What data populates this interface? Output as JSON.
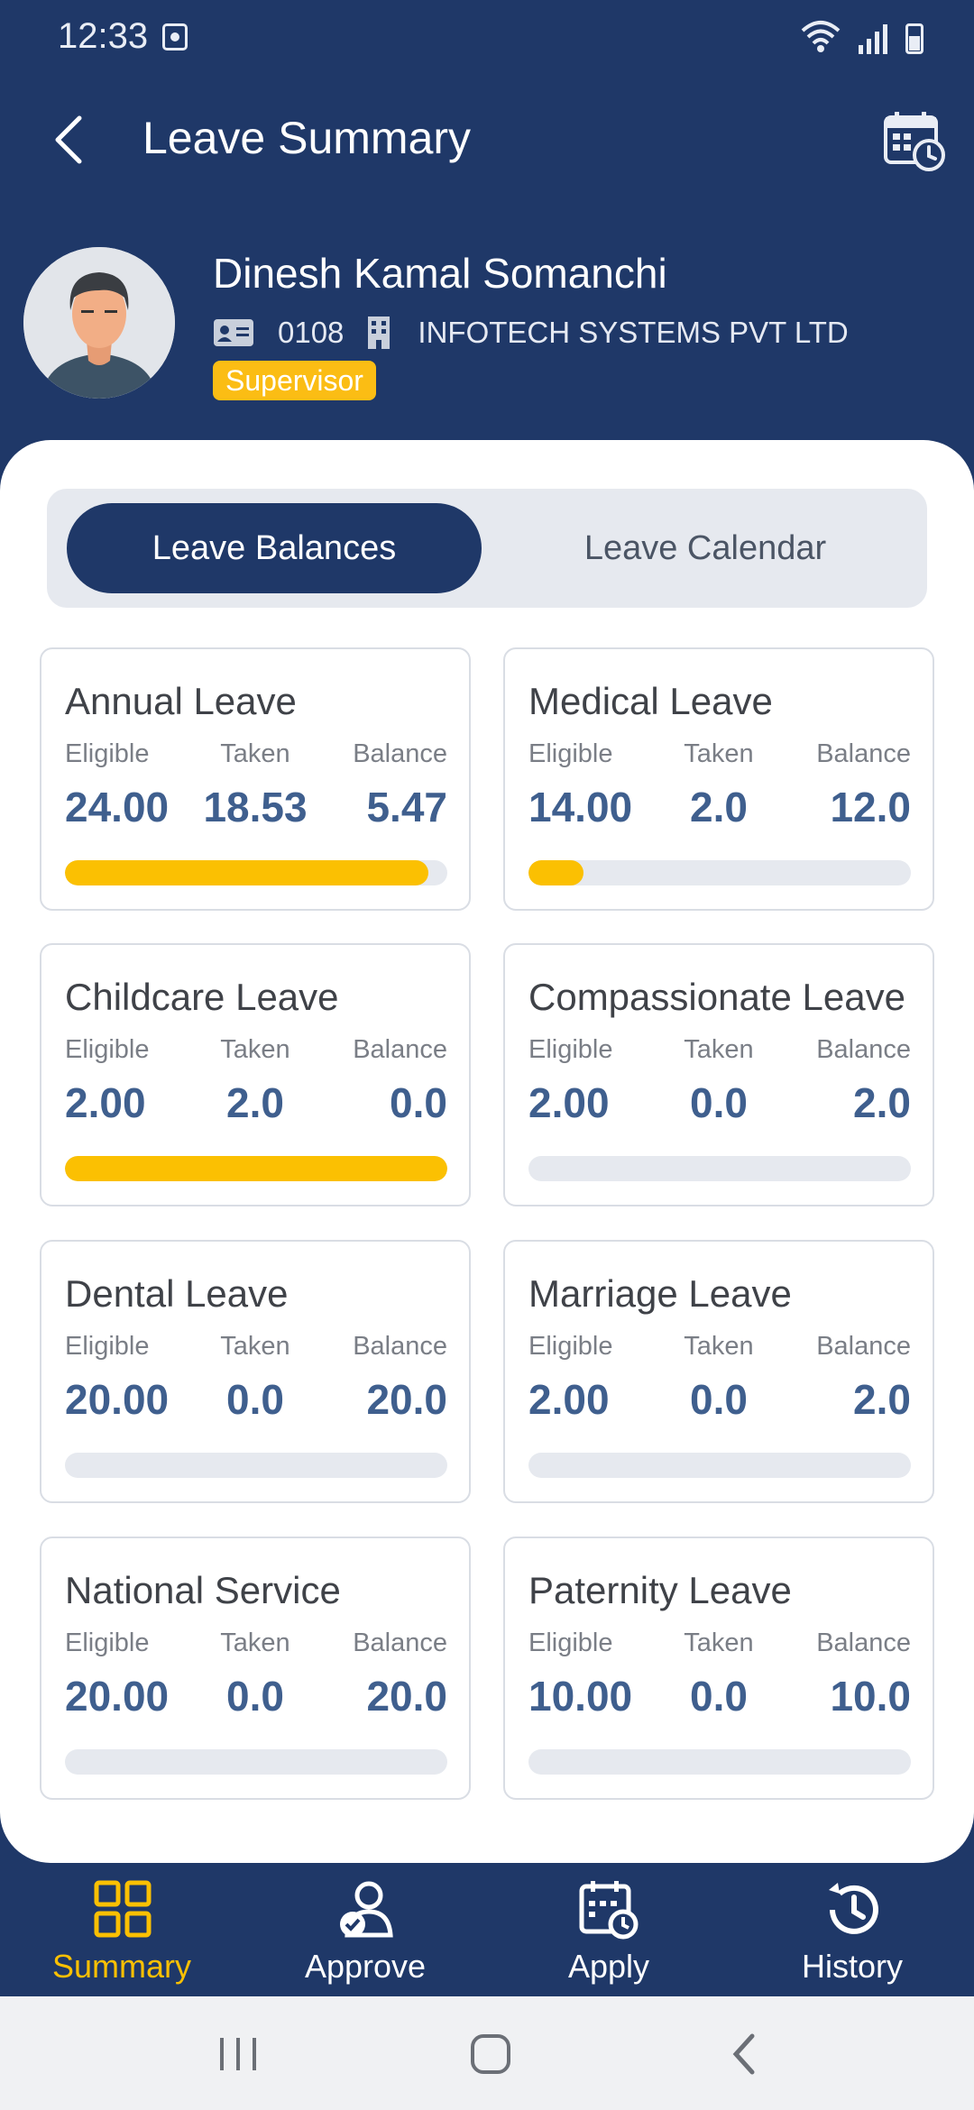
{
  "status": {
    "time": "12:33"
  },
  "header": {
    "title": "Leave Summary"
  },
  "profile": {
    "name": "Dinesh Kamal Somanchi",
    "employee_id": "0108",
    "company": "INFOTECH SYSTEMS PVT LTD",
    "role": "Supervisor"
  },
  "tabs": {
    "active": "Leave Balances",
    "inactive": "Leave Calendar"
  },
  "labels": {
    "eligible": "Eligible",
    "taken": "Taken",
    "balance": "Balance"
  },
  "leaves": [
    {
      "name": "Annual Leave",
      "eligible": "24.00",
      "taken": "18.53",
      "balance": "5.47",
      "used_fraction": 0.95
    },
    {
      "name": "Medical Leave",
      "eligible": "14.00",
      "taken": "2.0",
      "balance": "12.0",
      "used_fraction": 0.143
    },
    {
      "name": "Childcare Leave",
      "eligible": "2.00",
      "taken": "2.0",
      "balance": "0.0",
      "used_fraction": 1.0
    },
    {
      "name": "Compassionate Leave",
      "eligible": "2.00",
      "taken": "0.0",
      "balance": "2.0",
      "used_fraction": 0.0
    },
    {
      "name": "Dental Leave",
      "eligible": "20.00",
      "taken": "0.0",
      "balance": "20.0",
      "used_fraction": 0.0
    },
    {
      "name": "Marriage Leave",
      "eligible": "2.00",
      "taken": "0.0",
      "balance": "2.0",
      "used_fraction": 0.0
    },
    {
      "name": "National Service",
      "eligible": "20.00",
      "taken": "0.0",
      "balance": "20.0",
      "used_fraction": 0.0
    },
    {
      "name": "Paternity Leave",
      "eligible": "10.00",
      "taken": "0.0",
      "balance": "10.0",
      "used_fraction": 0.0
    }
  ],
  "nav": {
    "summary": "Summary",
    "approve": "Approve",
    "apply": "Apply",
    "history": "History"
  },
  "colors": {
    "primary": "#1f3868",
    "accent": "#fbc002",
    "value": "#3f5f8e"
  }
}
